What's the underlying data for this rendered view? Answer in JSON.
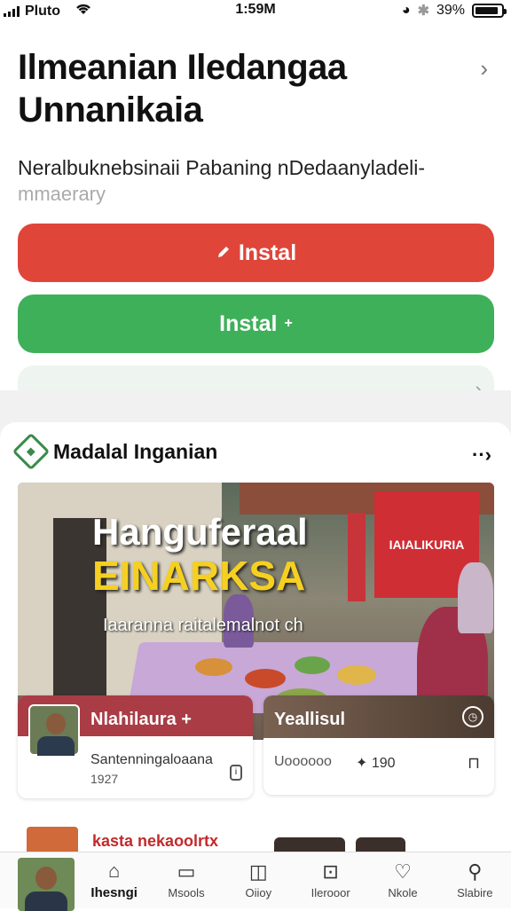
{
  "status_bar": {
    "carrier": "Pluto",
    "time": "1:59M",
    "battery_text": "39%"
  },
  "header": {
    "title_line1": "Ilmeanian Iledangaa",
    "title_line2": "Unnanikaia",
    "subtitle": "Neralbuknebsinaii Pabaning nDedaanyladeli-",
    "subtitle_cont": "mmaerary"
  },
  "buttons": {
    "install_primary": "Instal",
    "install_secondary": "Instal",
    "install_primary_icon": "pencil-icon",
    "install_secondary_icon": "plus-icon",
    "primary_color": "#e0453a",
    "secondary_color": "#3fb05a"
  },
  "section": {
    "title": "Madalal Inganian",
    "more_label": "··›"
  },
  "hero": {
    "title_line1": "Hanguferaal",
    "title_line2": "EINARKSA",
    "caption": "Iaaranna raitalemalnot ch",
    "banner_text": "IAIALIKURIA"
  },
  "cards": [
    {
      "name": "Nlahilaura +",
      "description": "Santenningaloaana",
      "number": "1927"
    },
    {
      "name": "Yeallisul",
      "meta": "Uoooooo",
      "rating": "✦ 190"
    }
  ],
  "peek": {
    "label": "kasta nekaoolrtx"
  },
  "tabbar": {
    "items": [
      {
        "label": "Ihesngi",
        "icon": "home-icon"
      },
      {
        "label": "Msools",
        "icon": "box-icon"
      },
      {
        "label": "Oiioy",
        "icon": "book-icon"
      },
      {
        "label": "Ilerooor",
        "icon": "bag-icon"
      },
      {
        "label": "Nkole",
        "icon": "heart-icon"
      },
      {
        "label": "Slabire",
        "icon": "user-icon"
      }
    ]
  }
}
